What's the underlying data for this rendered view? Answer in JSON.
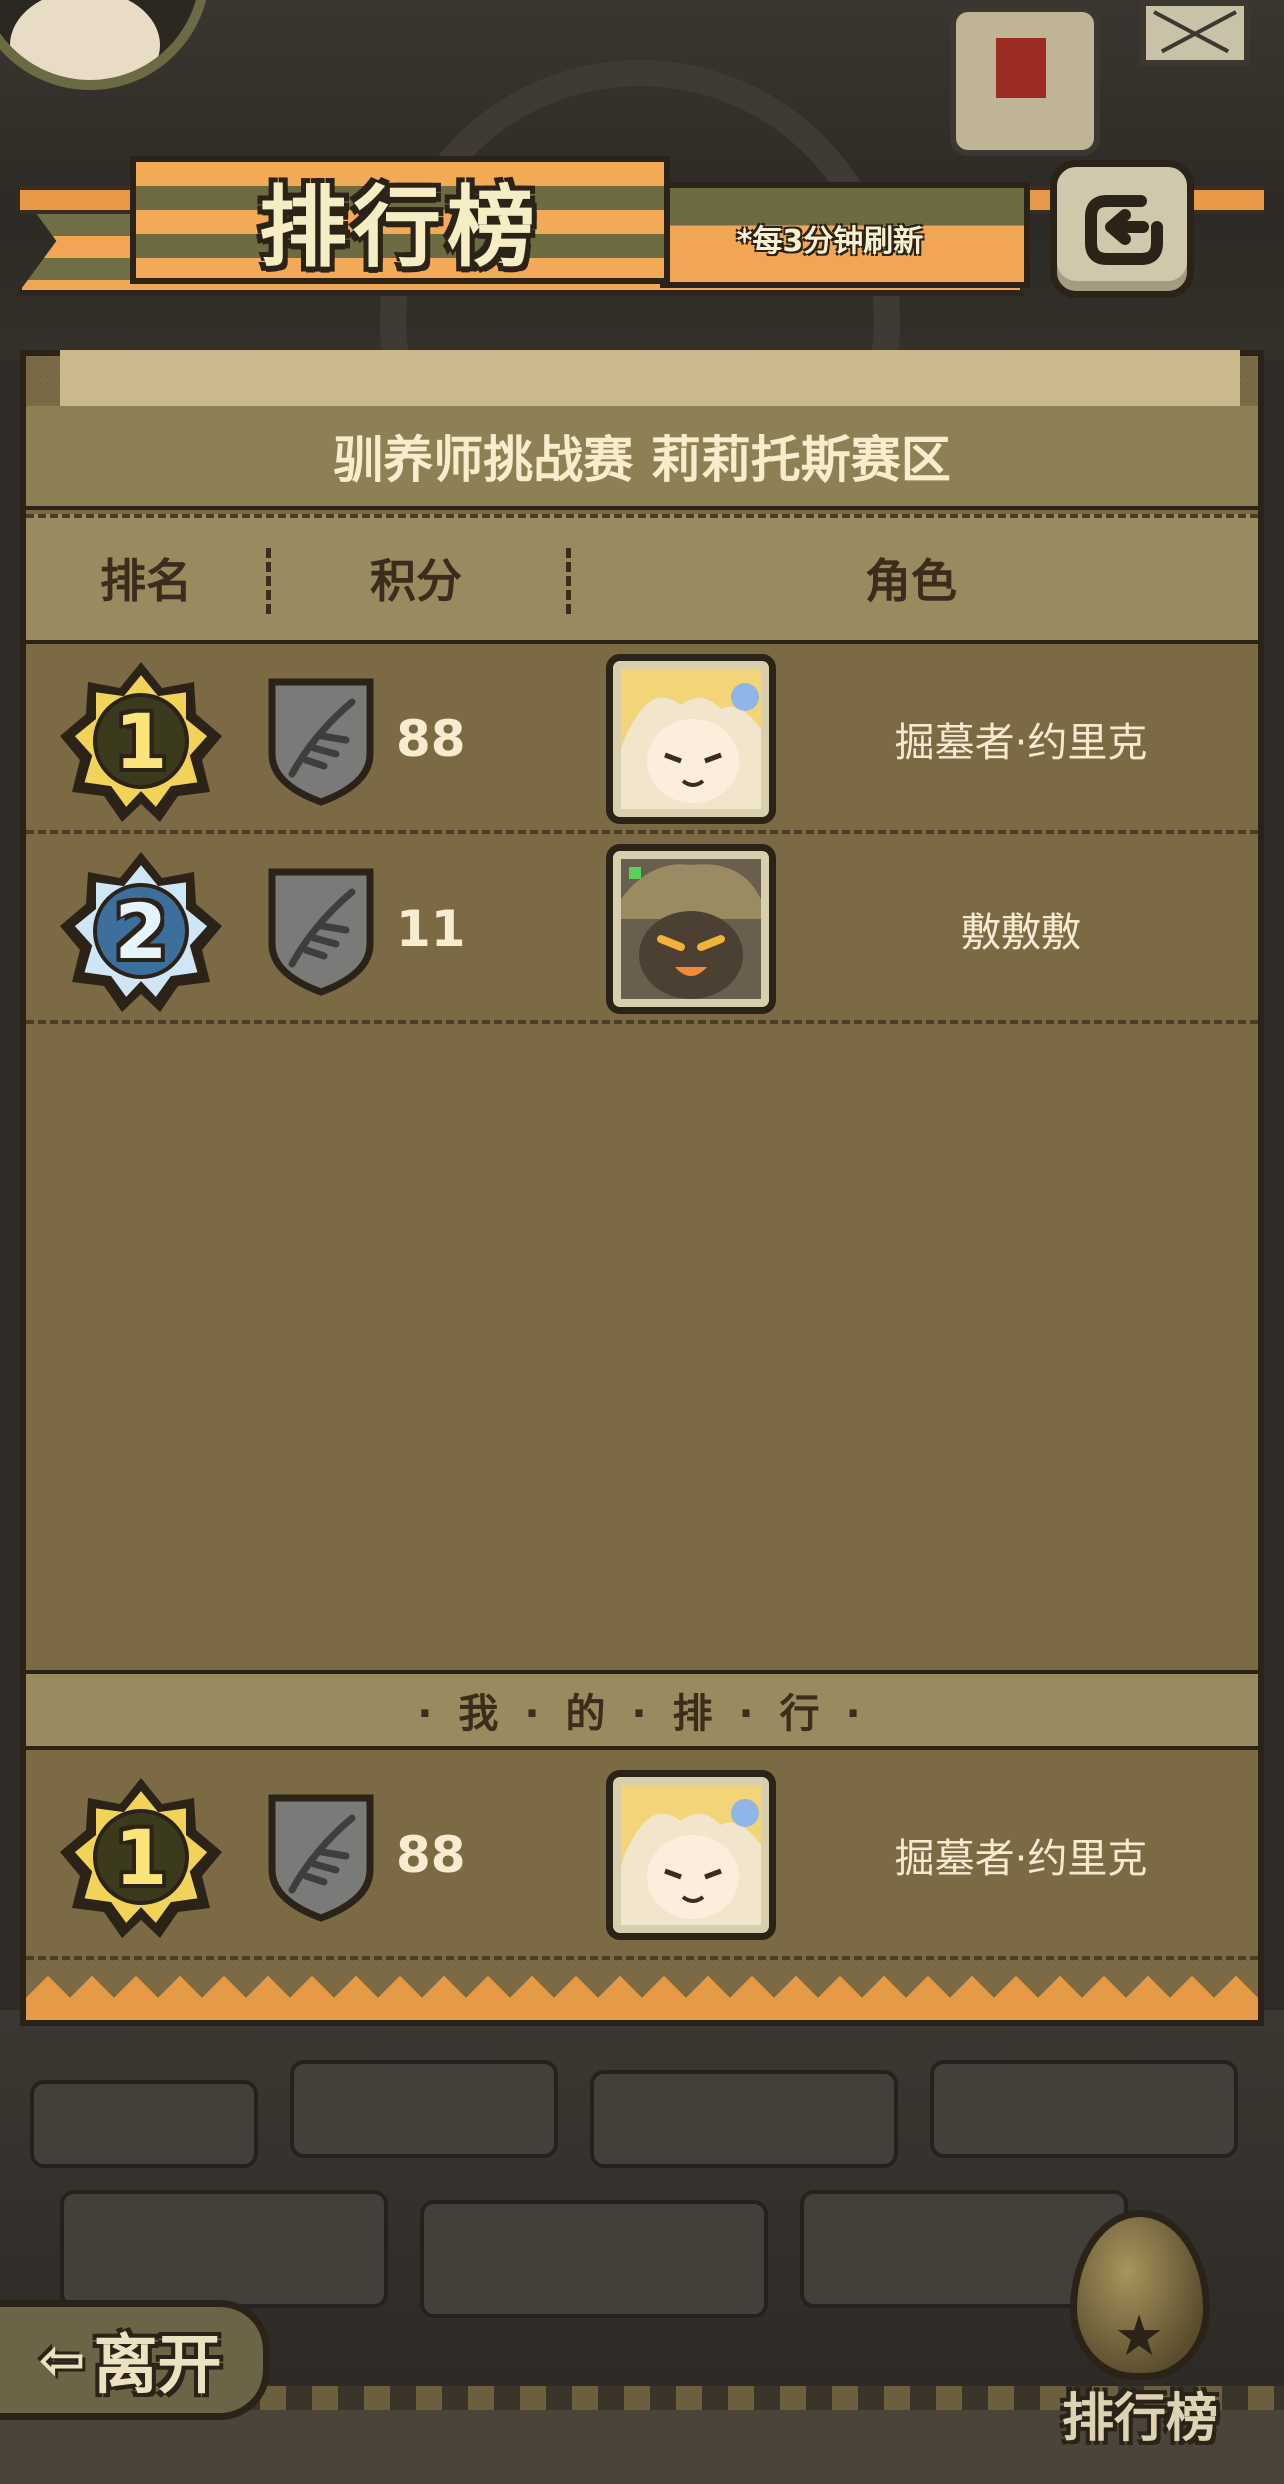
{
  "header": {
    "title": "排行榜",
    "refresh_note": "*每3分钟刷新"
  },
  "season": {
    "title": "驯养师挑战赛 莉莉托斯赛区"
  },
  "columns": {
    "rank": "排名",
    "score": "积分",
    "role": "角色"
  },
  "rows": [
    {
      "rank": "1",
      "score": "88",
      "name": "掘墓者·约里克"
    },
    {
      "rank": "2",
      "score": "11",
      "name": "敷敷敷"
    }
  ],
  "my_rank": {
    "label": "· 我 · 的 · 排 · 行 ·",
    "rank": "1",
    "score": "88",
    "name": "掘墓者·约里克"
  },
  "footer": {
    "leave_arrow": "⇦",
    "leave_label": "离开",
    "leaderboard_label": "排行榜"
  },
  "icons": {
    "back": "back-icon",
    "shield": "feather-shield-icon",
    "leaderboard": "egg-star-icon"
  },
  "colors": {
    "banner_orange": "#f1a653",
    "panel_brown": "#7b6a44",
    "gold": "#fbe57a",
    "silver": "#e6f4ff"
  }
}
